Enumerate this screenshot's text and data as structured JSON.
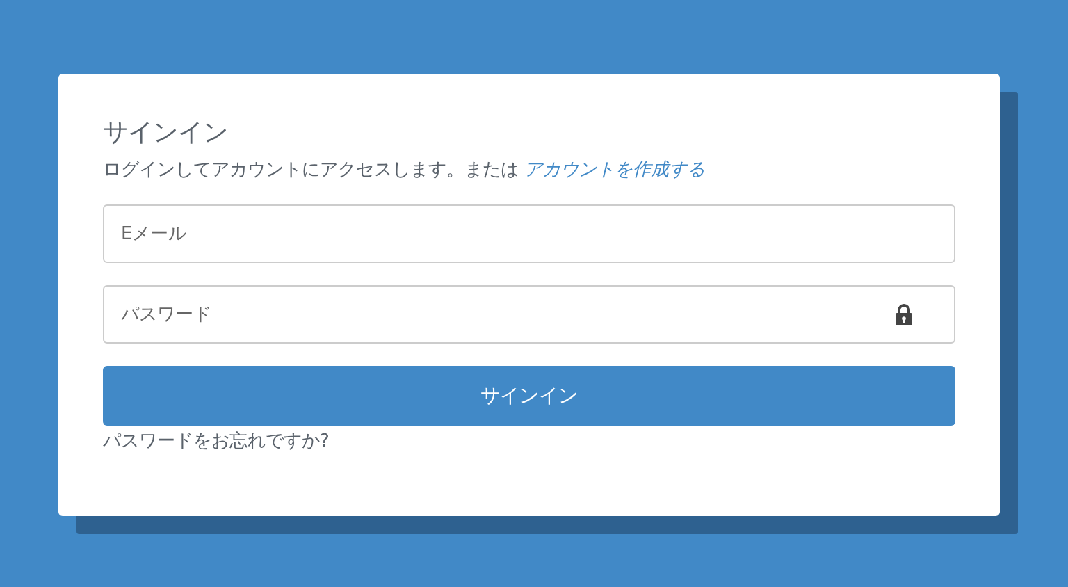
{
  "title": "サインイン",
  "subtitle": {
    "text": "ログインしてアカウントにアクセスします。または",
    "link": "アカウントを作成する"
  },
  "email": {
    "placeholder": "Eメール"
  },
  "password": {
    "placeholder": "パスワード"
  },
  "submit": "サインイン",
  "forgot": "パスワードをお忘れですか?"
}
